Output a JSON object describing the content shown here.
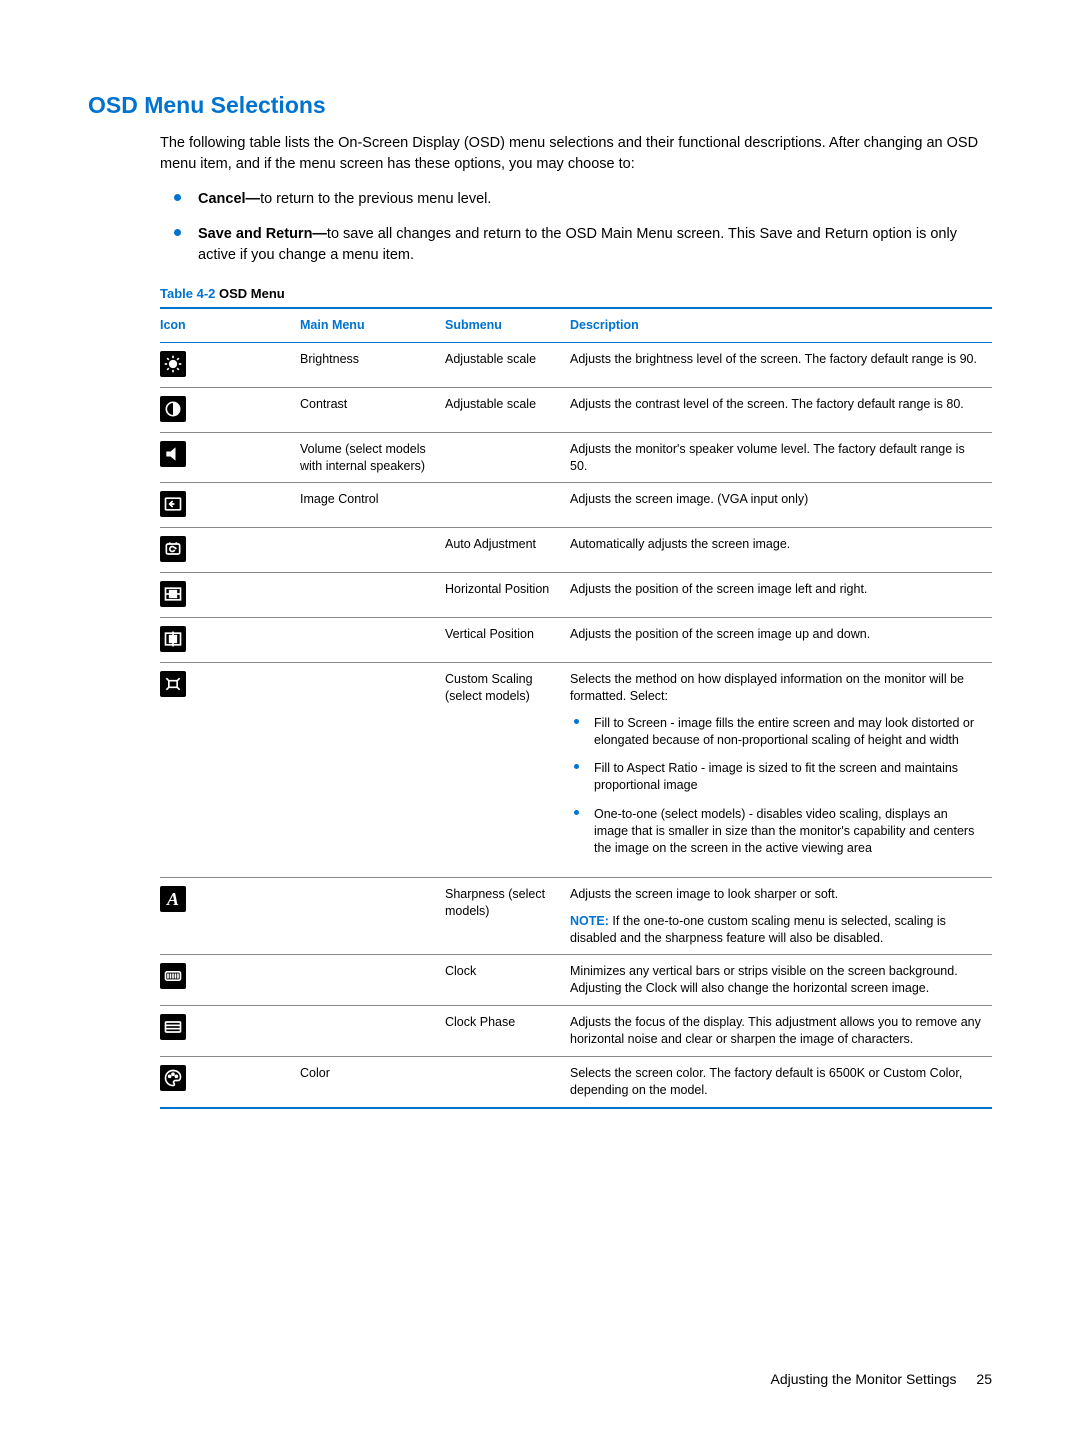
{
  "heading": "OSD Menu Selections",
  "intro": "The following table lists the On-Screen Display (OSD) menu selections and their functional descriptions. After changing an OSD menu item, and if the menu screen has these options, you may choose to:",
  "bullets": [
    {
      "lead": "Cancel—",
      "text": "to return to the previous menu level."
    },
    {
      "lead": "Save and Return—",
      "text": "to save all changes and return to the OSD Main Menu screen. This Save and Return option is only active if you change a menu item."
    }
  ],
  "tableCaption": {
    "label": "Table 4-2",
    "title": "OSD Menu"
  },
  "tableHeaders": {
    "icon": "Icon",
    "main": "Main Menu",
    "sub": "Submenu",
    "desc": "Description"
  },
  "rows": {
    "r0": {
      "main": "Brightness",
      "sub": "Adjustable scale",
      "desc": "Adjusts the brightness level of the screen. The factory default range is 90."
    },
    "r1": {
      "main": "Contrast",
      "sub": "Adjustable scale",
      "desc": "Adjusts the contrast level of the screen. The factory default range is 80."
    },
    "r2": {
      "main": "Volume (select models with internal speakers)",
      "sub": "",
      "desc": "Adjusts the monitor's speaker volume level. The factory default range is 50."
    },
    "r3": {
      "main": "Image Control",
      "sub": "",
      "desc": "Adjusts the screen image. (VGA input only)"
    },
    "r4": {
      "main": "",
      "sub": "Auto Adjustment",
      "desc": "Automatically adjusts the screen image."
    },
    "r5": {
      "main": "",
      "sub": "Horizontal Position",
      "desc": "Adjusts the position of the screen image left and right."
    },
    "r6": {
      "main": "",
      "sub": "Vertical Position",
      "desc": "Adjusts the position of the screen image up and down."
    },
    "r7": {
      "main": "",
      "sub": "Custom Scaling (select models)",
      "desc": "Selects the method on how displayed information on the monitor will be formatted. Select:",
      "list": {
        "i0": "Fill to Screen - image fills the entire screen and may look distorted or elongated because of non-proportional scaling of height and width",
        "i1": "Fill to Aspect Ratio - image is sized to fit the screen and maintains proportional image",
        "i2": "One-to-one (select models) - disables video scaling, displays an image that is smaller in size than the monitor's capability and centers the image on the screen in the active viewing area"
      }
    },
    "r8": {
      "main": "",
      "sub": "Sharpness (select models)",
      "desc": "Adjusts the screen image to look sharper or soft.",
      "noteLead": "NOTE:",
      "note": "If the one-to-one custom scaling menu is selected, scaling is disabled and the sharpness feature will also be disabled."
    },
    "r9": {
      "main": "",
      "sub": "Clock",
      "desc": "Minimizes any vertical bars or strips visible on the screen background. Adjusting the Clock will also change the horizontal screen image."
    },
    "r10": {
      "main": "",
      "sub": "Clock Phase",
      "desc": "Adjusts the focus of the display. This adjustment allows you to remove any horizontal noise and clear or sharpen the image of characters."
    },
    "r11": {
      "main": "Color",
      "sub": "",
      "desc": "Selects the screen color. The factory default is 6500K or Custom Color, depending on the model."
    }
  },
  "footer": {
    "text": "Adjusting the Monitor Settings",
    "page": "25"
  }
}
